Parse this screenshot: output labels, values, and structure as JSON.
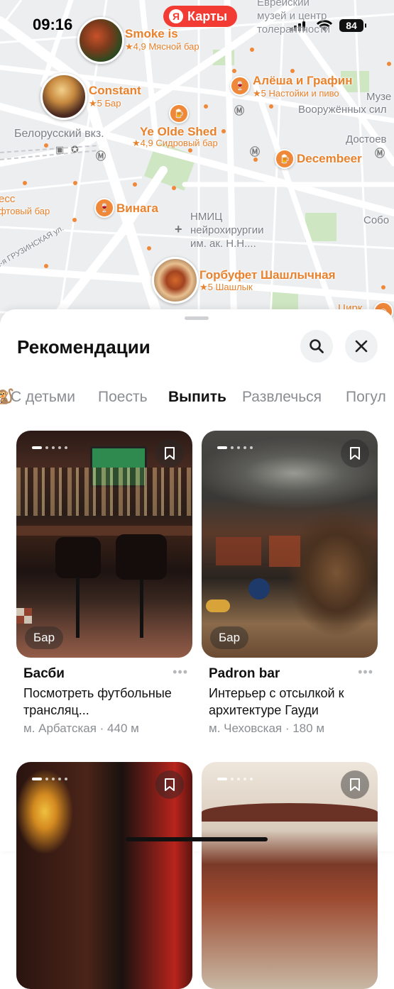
{
  "status_bar": {
    "time": "09:16",
    "battery": "84"
  },
  "map": {
    "brand": "Карты",
    "brand_logo": "Я",
    "labels": {
      "museum": "Еврейский\nмузей и центр\nтолерантности",
      "station": "Белорусский вкз.",
      "armory": "Вооружённых сил",
      "museum_short": "Музе",
      "dostoev": "Достоев",
      "sobor": "Собо",
      "nmic": "НМИЦ\nнейрохирургии\nим. ак. Н.Н....",
      "street": "1-я ГРУЗИНСКАЯ ул.",
      "tsirk": "Цирк",
      "left_name": "есс",
      "left_sub": "фтовый бар"
    },
    "pois": [
      {
        "name": "Smoke is",
        "sub": "★4,9 Мясной бар"
      },
      {
        "name": "Constant",
        "sub": "★5 Бар"
      },
      {
        "name": "Алёша и Графин",
        "sub": "★5 Настойки и пиво"
      },
      {
        "name": "Ye Olde Shed",
        "sub": "★4,9 Сидровый бар"
      },
      {
        "name": "Decembeer",
        "sub": ""
      },
      {
        "name": "Винага",
        "sub": ""
      },
      {
        "name": "Горбуфет Шашлычная",
        "sub": "★5 Шашлык"
      }
    ]
  },
  "sheet": {
    "title": "Рекомендации",
    "tabs": [
      "С детьми",
      "Поесть",
      "Выпить",
      "Развлечься",
      "Погул"
    ],
    "active_tab": "Выпить"
  },
  "cards": [
    {
      "badge": "Бар",
      "title": "Басби",
      "more": "•••",
      "desc": "Посмотреть футбольные трансляц...",
      "meta": "м. Арбатская · 440 м"
    },
    {
      "badge": "Бар",
      "title": "Padron bar",
      "more": "•••",
      "desc": "Интерьер с отсылкой к архитектуре Гауди",
      "meta": "м. Чеховская · 180 м"
    },
    {
      "badge": "",
      "title": "",
      "more": "",
      "desc": "",
      "meta": ""
    },
    {
      "badge": "",
      "title": "",
      "more": "",
      "desc": "",
      "meta": ""
    }
  ],
  "colors": {
    "accent": "#e8822c",
    "brand": "#f23b32",
    "map_bg": "#eceef0"
  },
  "icons": [
    "search-icon",
    "close-icon",
    "bookmark-icon",
    "metro-icon",
    "wifi-icon"
  ]
}
